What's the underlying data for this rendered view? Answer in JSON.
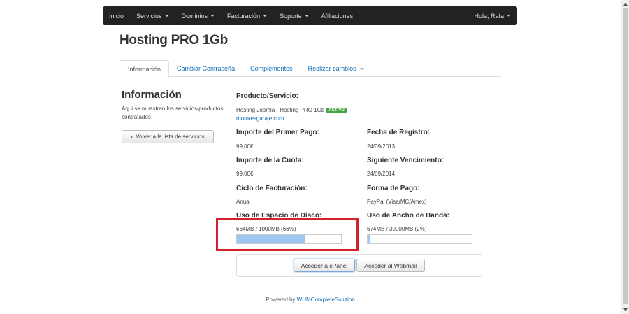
{
  "navbar": {
    "items": [
      {
        "label": "Inicio",
        "dropdown": false
      },
      {
        "label": "Servicios",
        "dropdown": true
      },
      {
        "label": "Dominios",
        "dropdown": true
      },
      {
        "label": "Facturación",
        "dropdown": true
      },
      {
        "label": "Soporte",
        "dropdown": true
      },
      {
        "label": "Afiliaciones",
        "dropdown": false
      }
    ],
    "user": "Hola, Rafa"
  },
  "page_title": "Hosting PRO 1Gb",
  "tabs": [
    {
      "label": "Información",
      "active": true
    },
    {
      "label": "Cambiar Contraseña",
      "active": false
    },
    {
      "label": "Complementos",
      "active": false
    },
    {
      "label": "Realizar cambios",
      "active": false,
      "dropdown": true
    }
  ],
  "sidebar": {
    "title": "Información",
    "description": "Aqui se muestran los servicios/productos contratados",
    "back_button": "« Volver a la lista de servicios"
  },
  "details": {
    "product_label": "Producto/Servicio:",
    "product_value": "Hosting Joomla - Hosting PRO 1Gb",
    "status_badge": "ACTIVO",
    "domain": "motoresgaraje.com",
    "first_payment_label": "Importe del Primer Pago:",
    "first_payment_value": "99,00€",
    "registration_label": "Fecha de Registro:",
    "registration_value": "24/09/2013",
    "fee_label": "Importe de la Cuota:",
    "fee_value": "99,00€",
    "next_due_label": "Siguiente Vencimiento:",
    "next_due_value": "24/09/2014",
    "billing_cycle_label": "Ciclo de Facturación:",
    "billing_cycle_value": "Anual",
    "payment_method_label": "Forma de Pago:",
    "payment_method_value": "PayPal (Visa/MC/Amex)",
    "disk_label": "Uso de Espacio de Disco:",
    "disk_value": "664MB / 1000MB (66%)",
    "disk_percent": 66,
    "bandwidth_label": "Uso de Ancho de Banda:",
    "bandwidth_value": "674MB / 30000MB (2%)",
    "bandwidth_percent": 2
  },
  "actions": {
    "cpanel": "Acceder a cPanel",
    "webmail": "Acceder al Webmail"
  },
  "footer": {
    "prefix": "Powered by",
    "link": "WHMCompleteSolution"
  },
  "colors": {
    "navbar_bg": "#222222",
    "link": "#0e6bb5",
    "badge": "#46a546",
    "highlight": "#d3232a",
    "progress_fill": "#9cc7ef"
  }
}
